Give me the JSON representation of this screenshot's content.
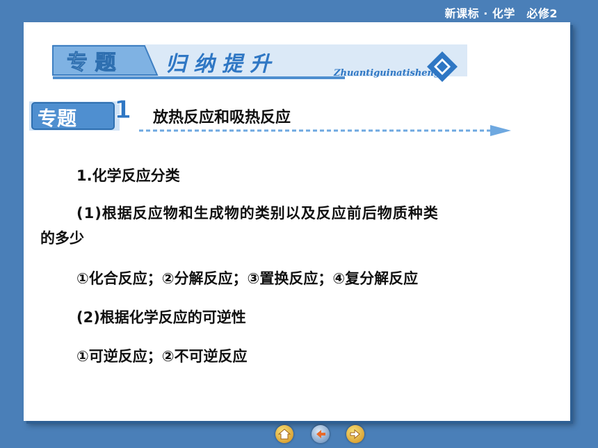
{
  "header": {
    "title": "新课标 · 化学　必修2"
  },
  "banner": {
    "label": "专 题",
    "heading": "归 纳 提 升",
    "pinyin": "Zhuantiguinatisheng"
  },
  "topic": {
    "badge": "专题",
    "number": "1",
    "title": "放热反应和吸热反应"
  },
  "content": {
    "section_heading": "1.化学反应分类",
    "item1_line1": "(1)根据反应物和生成物的类别以及反应前后物质种类",
    "item1_line2": "的多少",
    "item1_list": "①化合反应；②分解反应；③置换反应；④复分解反应",
    "item2_heading": "(2)根据化学反应的可逆性",
    "item2_list": "①可逆反应；②不可逆反应"
  },
  "nav": {
    "home_icon": "home-icon",
    "back_icon": "back-icon",
    "next_icon": "next-icon"
  },
  "colors": {
    "background": "#4a7fb8",
    "banner_blue": "#4f8fd0",
    "accent_light": "#cfe2f6"
  }
}
